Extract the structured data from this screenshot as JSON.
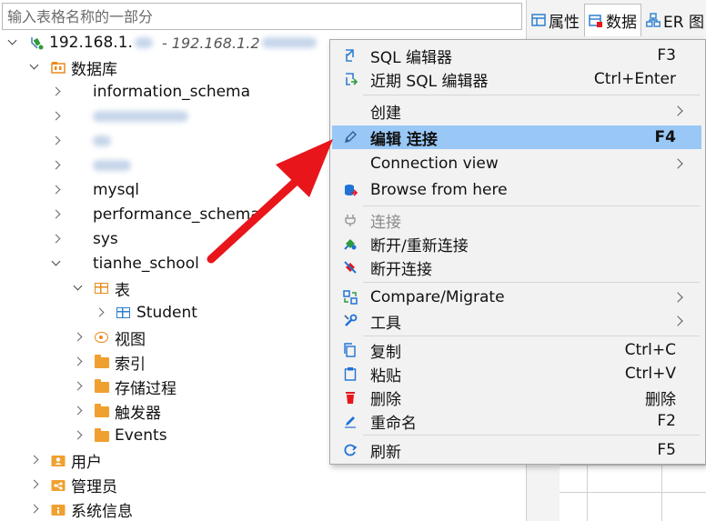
{
  "search": {
    "placeholder": "输入表格名称的一部分"
  },
  "right_tabs": [
    {
      "label": "属性",
      "icon": "properties-icon"
    },
    {
      "label": "数据",
      "icon": "data-icon"
    },
    {
      "label": "ER 图",
      "icon": "er-diagram-icon"
    }
  ],
  "tree": {
    "connection": {
      "name": "192.168.1.",
      "desc": "- 192.168.1.2"
    },
    "databases_label": "数据库",
    "items": {
      "information_schema": "information_schema",
      "mysql": "mysql",
      "performance_schema": "performance_schema",
      "sys": "sys",
      "tianhe_school": "tianhe_school"
    },
    "tianhe": {
      "tables_label": "表",
      "student": "Student",
      "views": "视图",
      "indexes": "索引",
      "procedures": "存储过程",
      "triggers": "触发器",
      "events": "Events"
    },
    "users": "用户",
    "admin": "管理员",
    "sysinfo": "系统信息"
  },
  "context_menu": {
    "sql_editor": {
      "label": "SQL 编辑器",
      "shortcut": "F3"
    },
    "recent_sql": {
      "label": "近期 SQL 编辑器",
      "shortcut": "Ctrl+Enter"
    },
    "create": {
      "label": "创建"
    },
    "edit_conn": {
      "label": "编辑 连接",
      "shortcut": "F4"
    },
    "conn_view": {
      "label": "Connection view"
    },
    "browse": {
      "label": "Browse from here"
    },
    "connect": {
      "label": "连接"
    },
    "reconnect": {
      "label": "断开/重新连接"
    },
    "disconnect": {
      "label": "断开连接"
    },
    "compare": {
      "label": "Compare/Migrate"
    },
    "tools": {
      "label": "工具"
    },
    "copy": {
      "label": "复制",
      "shortcut": "Ctrl+C"
    },
    "paste": {
      "label": "粘贴",
      "shortcut": "Ctrl+V"
    },
    "delete": {
      "label": "删除",
      "shortcut": "删除"
    },
    "rename": {
      "label": "重命名",
      "shortcut": "F2"
    },
    "refresh": {
      "label": "刷新",
      "shortcut": "F5"
    }
  },
  "colors": {
    "selection": "#99c8f6",
    "arrow": "#e8151b",
    "db_icon": "#1f72d6",
    "folder_icon": "#f0a030"
  }
}
